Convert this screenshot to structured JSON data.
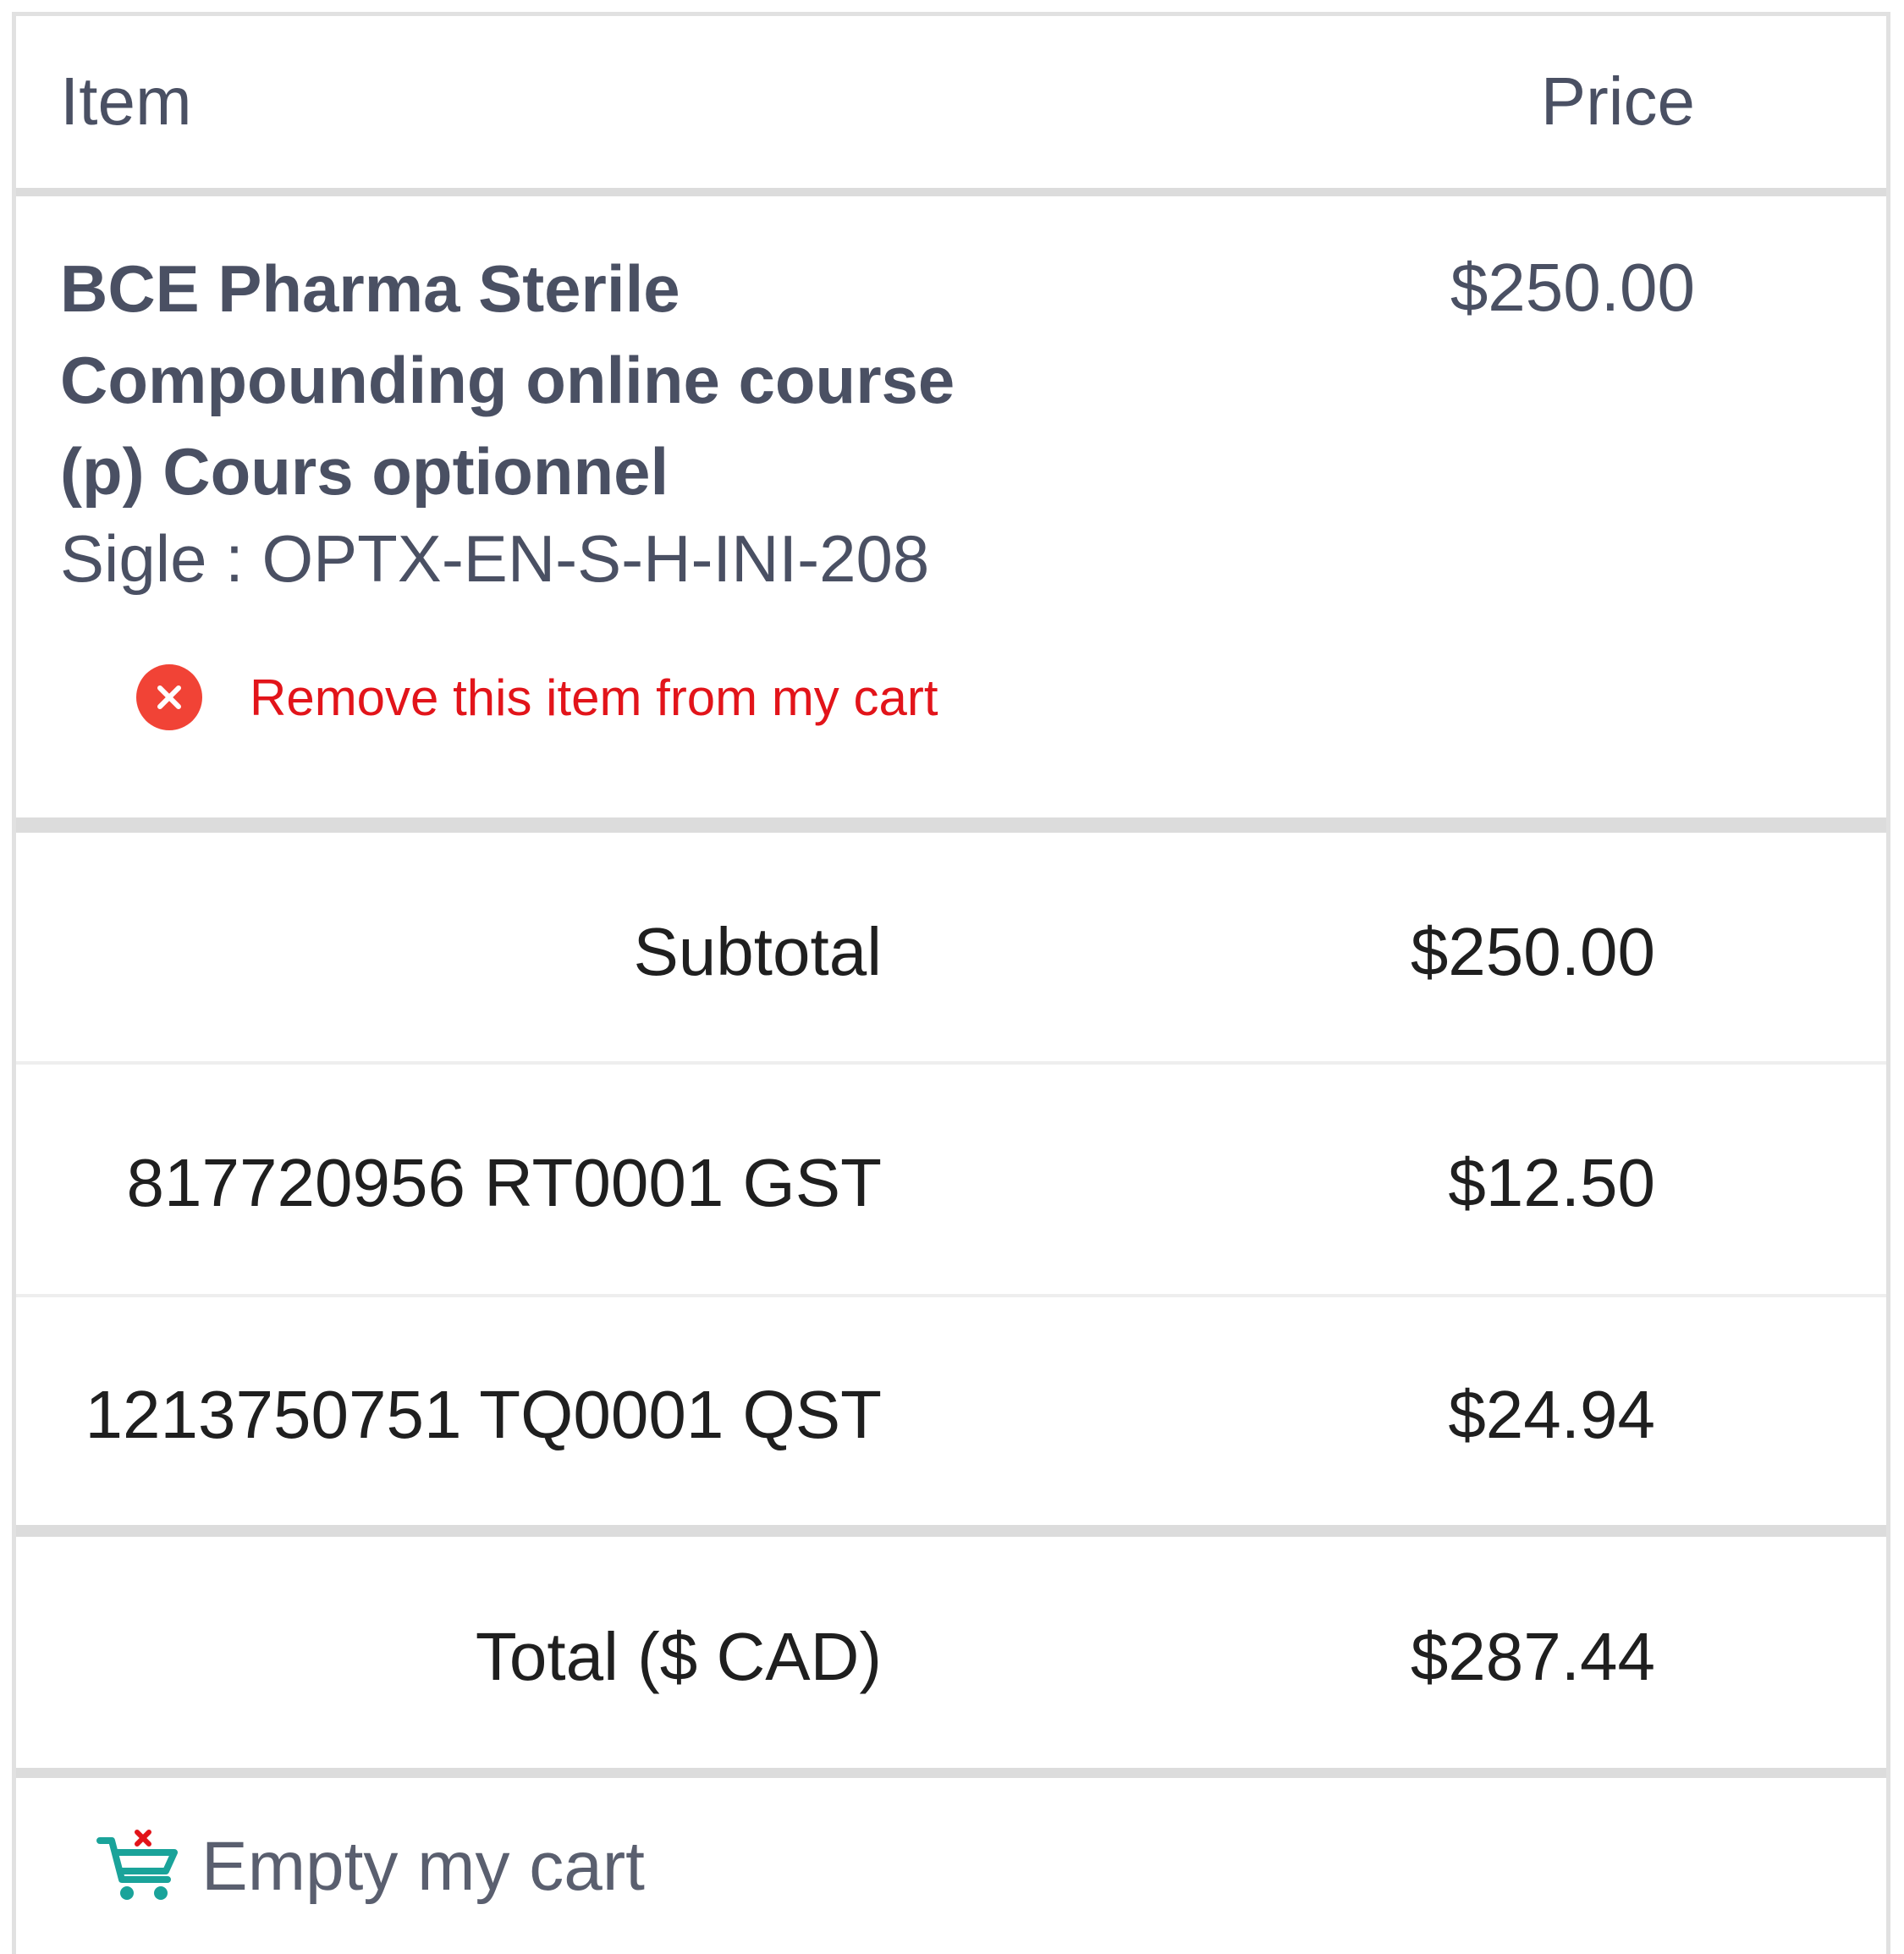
{
  "header": {
    "item_label": "Item",
    "price_label": "Price"
  },
  "item": {
    "title": "BCE Pharma Sterile Compounding online course (p) Cours optionnel",
    "code": "Sigle : OPTX-EN-S-H-INI-208",
    "price": "$250.00",
    "remove_label": "Remove this item from my cart",
    "remove_icon": "close-circle-icon"
  },
  "summary": {
    "subtotal_label": "Subtotal",
    "subtotal_value": "$250.00",
    "gst_label": "817720956 RT0001  GST",
    "gst_value": "$12.50",
    "qst_label": "1213750751 TQ0001  QST",
    "qst_value": "$24.94",
    "total_label": "Total ($ CAD)",
    "total_value": "$287.44"
  },
  "actions": {
    "empty_cart_label": "Empty my cart",
    "empty_cart_icon": "cart-remove-icon"
  },
  "colors": {
    "text": "#4a5063",
    "remove": "#e2141a",
    "remove_icon": "#f14336",
    "cart_icon": "#1aa39a",
    "cart_x": "#e2141a"
  }
}
